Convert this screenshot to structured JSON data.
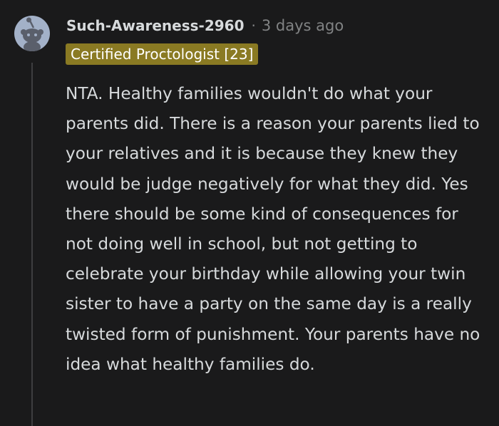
{
  "comment": {
    "username": "Such-Awareness-2960",
    "separator": "·",
    "timestamp": "3 days ago",
    "flair": "Certified Proctologist [23]",
    "body": "NTA. Healthy families wouldn't do what your parents did. There is a reason your parents lied to your relatives and it is because they knew they would be judge negatively for what they did. Yes there should be some kind of consequences for not doing well in school, but not getting to celebrate your birthday while allowing your twin sister to have a party on the same day is a really twisted form of punishment. Your parents have no idea what healthy families do.",
    "avatar_icon": "snoo-avatar-icon"
  },
  "colors": {
    "background": "#1a1a1b",
    "text": "#d7dadc",
    "meta": "#818384",
    "flair_bg": "#8a7a23",
    "avatar_bg": "#a3b1c8"
  }
}
